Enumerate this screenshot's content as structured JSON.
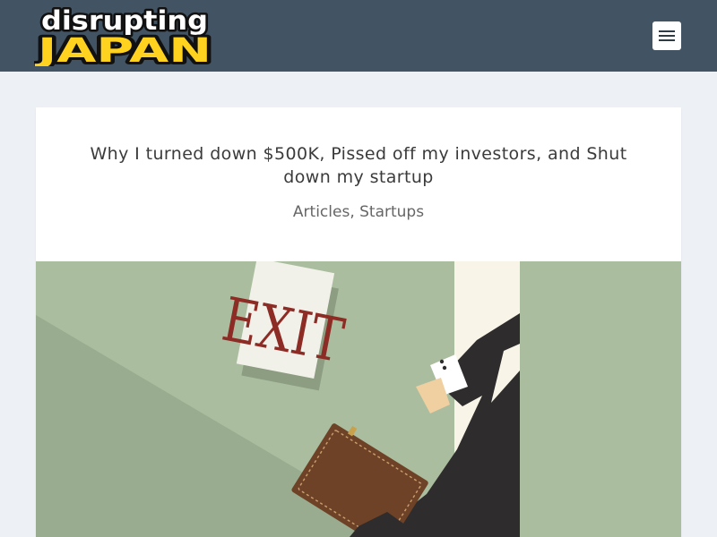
{
  "header": {
    "logo_line1": "disrupting",
    "logo_line2": "JAPAN",
    "menu_icon": "hamburger-icon",
    "background_color": "#425463"
  },
  "article": {
    "title": "Why I turned down $500K, Pissed off my investors, and Shut down my startup",
    "categories": [
      "Articles",
      "Startups"
    ],
    "category_separator": ", "
  },
  "hero": {
    "sign_text": "EXIT",
    "background_color": "#aabd9f"
  }
}
